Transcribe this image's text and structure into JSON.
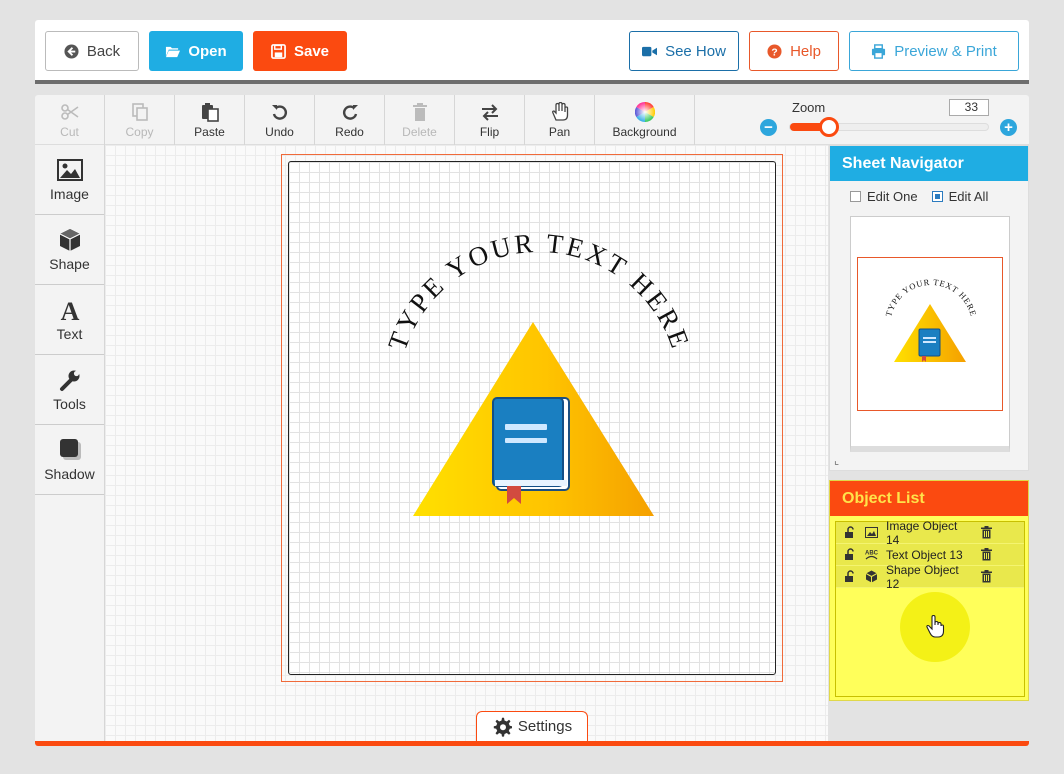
{
  "topbar": {
    "back": "Back",
    "open": "Open",
    "save": "Save",
    "see_how": "See How",
    "help": "Help",
    "preview_print": "Preview & Print"
  },
  "toolbar": {
    "cut": "Cut",
    "copy": "Copy",
    "paste": "Paste",
    "undo": "Undo",
    "redo": "Redo",
    "delete": "Delete",
    "flip": "Flip",
    "pan": "Pan",
    "background": "Background",
    "zoom_label": "Zoom",
    "zoom_value": "33",
    "zoom_level": 0.33
  },
  "sidebar": {
    "image": "Image",
    "shape": "Shape",
    "text": "Text",
    "tools": "Tools",
    "shadow": "Shadow"
  },
  "canvas": {
    "curved_text": "TYPE YOUR TEXT HERE"
  },
  "settings": "Settings",
  "navigator": {
    "title": "Sheet Navigator",
    "edit_one": "Edit One",
    "edit_all": "Edit All"
  },
  "object_list": {
    "title": "Object List",
    "items": [
      {
        "label": "Image Object 14",
        "icon": "image-icon"
      },
      {
        "label": "Text Object 13",
        "icon": "text-object-icon"
      },
      {
        "label": "Shape Object 12",
        "icon": "shape-icon"
      }
    ]
  },
  "colors": {
    "accent_orange": "#fb4a10",
    "accent_blue": "#1fade3",
    "highlight_yellow": "#ffff5a"
  }
}
